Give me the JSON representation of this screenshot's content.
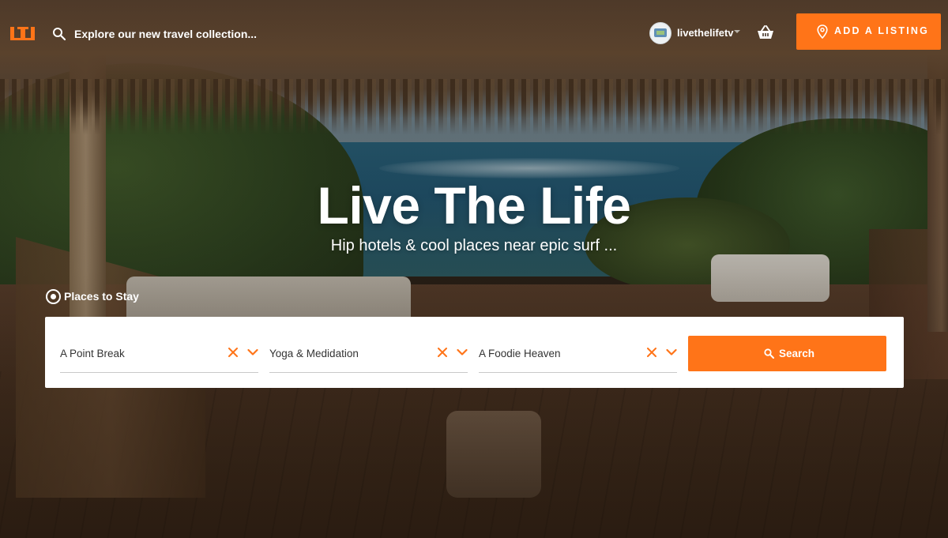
{
  "header": {
    "logo_text": "LTL",
    "search_placeholder": "Explore our new travel collection...",
    "username": "livethelifetv",
    "add_listing_label": "ADD A LISTING"
  },
  "hero": {
    "title": "Live The Life",
    "subtitle": "Hip hotels & cool places near epic surf ..."
  },
  "search": {
    "category_label": "Places to Stay",
    "fields": [
      {
        "value": "A Point Break"
      },
      {
        "value": "Yoga & Medidation"
      },
      {
        "value": "A Foodie Heaven"
      }
    ],
    "button_label": "Search"
  },
  "colors": {
    "accent": "#ff7418",
    "panel_bg": "#ffffff",
    "text_dark": "#333333"
  },
  "icons": [
    "ltl-logo-icon",
    "search-icon",
    "avatar",
    "chevron-down-icon",
    "basket-icon",
    "map-pin-icon",
    "radio-selected-icon",
    "clear-x-icon",
    "search-button-icon"
  ]
}
